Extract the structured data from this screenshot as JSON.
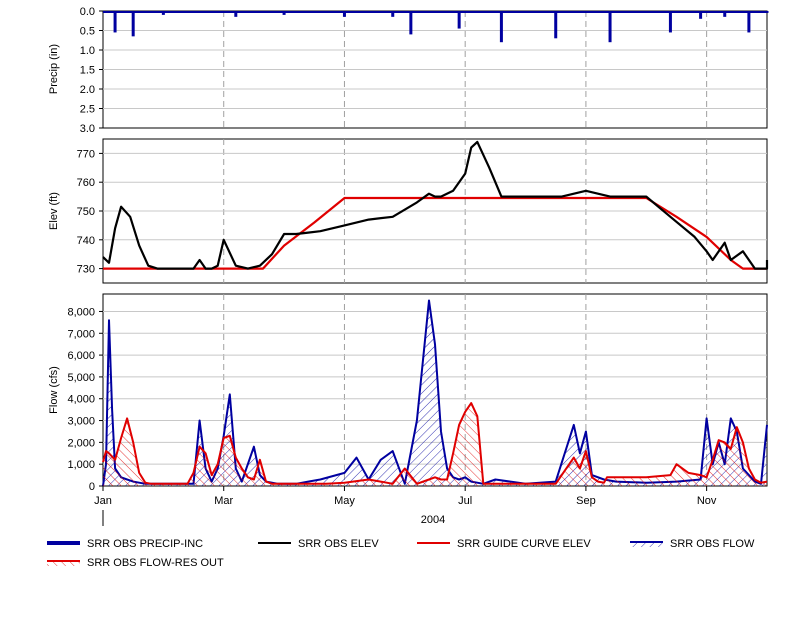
{
  "chart_data": [
    {
      "type": "bar",
      "ylabel": "Precip (in)",
      "ylim": [
        0,
        3.0
      ],
      "y_inverted": true,
      "yticks": [
        "0.0",
        "0.5",
        "1.0",
        "1.5",
        "2.0",
        "2.5",
        "3.0"
      ],
      "series": [
        {
          "name": "SRR OBS PRECIP-INC",
          "color": "#0000a0",
          "x": [
            0.2,
            0.5,
            1.0,
            1.4,
            2.2,
            3.0,
            4.0,
            4.8,
            5.1,
            5.9,
            6.6,
            7.5,
            7.7,
            8.4,
            9.4,
            9.9,
            10.3,
            10.7,
            11.0
          ],
          "values": [
            0.55,
            0.65,
            0.1,
            0.05,
            0.15,
            0.1,
            0.15,
            0.15,
            0.6,
            0.45,
            0.8,
            0.7,
            0.05,
            0.8,
            0.55,
            0.2,
            0.15,
            0.55,
            0.05
          ]
        }
      ]
    },
    {
      "type": "line",
      "ylabel": "Elev (ft)",
      "ylim": [
        725,
        775
      ],
      "yticks": [
        "730",
        "740",
        "750",
        "760",
        "770"
      ],
      "series": [
        {
          "name": "SRR OBS ELEV",
          "color": "#000000",
          "x": [
            0,
            0.1,
            0.2,
            0.3,
            0.45,
            0.6,
            0.75,
            0.9,
            1.5,
            1.6,
            1.7,
            1.8,
            1.9,
            2.0,
            2.2,
            2.4,
            2.6,
            2.8,
            3.0,
            3.2,
            3.4,
            3.6,
            3.8,
            4.0,
            4.4,
            4.8,
            5.2,
            5.4,
            5.5,
            5.6,
            5.8,
            6.0,
            6.1,
            6.2,
            6.4,
            6.6,
            7.0,
            7.6,
            8.0,
            8.4,
            9.0,
            9.4,
            9.8,
            10.0,
            10.1,
            10.3,
            10.4,
            10.6,
            10.8,
            11.0,
            11.0
          ],
          "values": [
            734,
            732,
            744,
            751.5,
            748,
            738,
            731,
            730,
            730,
            733,
            730,
            730,
            731,
            740,
            731,
            730,
            731,
            735,
            742,
            742,
            742.5,
            743,
            744,
            745,
            747,
            748,
            753,
            756,
            755,
            755,
            757,
            763,
            772,
            774,
            765,
            755,
            755,
            755,
            757,
            755,
            755,
            748,
            741,
            736,
            733,
            739,
            733,
            736,
            730,
            730,
            733
          ]
        },
        {
          "name": "SRR GUIDE CURVE ELEV",
          "color": "#e00000",
          "x": [
            0,
            2.65,
            3.0,
            3.5,
            4.0,
            5.0,
            6.0,
            7.0,
            8.0,
            8.3,
            9.0,
            9.5,
            10.0,
            10.4,
            10.6,
            11.0
          ],
          "values": [
            730,
            730,
            738,
            746,
            754.5,
            754.5,
            754.5,
            754.5,
            754.5,
            754.5,
            754.5,
            748,
            741,
            733,
            730,
            730
          ]
        }
      ]
    },
    {
      "type": "area",
      "ylabel": "Flow (cfs)",
      "xlabel": "2004",
      "categories": [
        "Jan",
        "Mar",
        "May",
        "Jul",
        "Sep",
        "Nov"
      ],
      "ylim": [
        0,
        8800
      ],
      "yticks": [
        "0",
        "1,000",
        "2,000",
        "3,000",
        "4,000",
        "5,000",
        "6,000",
        "7,000",
        "8,000"
      ],
      "series": [
        {
          "name": "SRR OBS FLOW",
          "color": "#0000a0",
          "x": [
            0,
            0.05,
            0.1,
            0.15,
            0.2,
            0.3,
            0.4,
            0.5,
            0.6,
            0.7,
            0.8,
            1.0,
            1.4,
            1.5,
            1.6,
            1.7,
            1.8,
            1.9,
            2.0,
            2.1,
            2.2,
            2.3,
            2.5,
            2.6,
            2.7,
            2.9,
            3.0,
            3.2,
            3.4,
            3.6,
            4.0,
            4.2,
            4.4,
            4.6,
            4.8,
            5.0,
            5.2,
            5.4,
            5.5,
            5.6,
            5.7,
            5.8,
            5.9,
            6.0,
            6.1,
            6.2,
            6.3,
            6.5,
            7.0,
            7.5,
            7.8,
            7.9,
            8.0,
            8.1,
            8.3,
            8.5,
            9.0,
            9.5,
            9.9,
            10.0,
            10.1,
            10.2,
            10.3,
            10.4,
            10.5,
            10.6,
            10.8,
            10.9,
            11.0
          ],
          "values": [
            0,
            1000,
            7600,
            3500,
            800,
            400,
            300,
            200,
            150,
            100,
            100,
            100,
            100,
            100,
            3000,
            800,
            200,
            800,
            2300,
            4200,
            800,
            200,
            1800,
            500,
            200,
            100,
            100,
            100,
            200,
            300,
            600,
            1300,
            300,
            1200,
            1600,
            100,
            3000,
            8500,
            6500,
            2500,
            800,
            400,
            300,
            400,
            200,
            150,
            100,
            300,
            100,
            200,
            2800,
            1500,
            2500,
            500,
            300,
            200,
            150,
            200,
            300,
            3100,
            1000,
            2000,
            1000,
            3100,
            2500,
            800,
            200,
            100,
            2800
          ]
        },
        {
          "name": "SRR OBS FLOW-RES OUT",
          "color": "#e00000",
          "x": [
            0,
            0.05,
            0.1,
            0.2,
            0.3,
            0.4,
            0.5,
            0.6,
            0.7,
            0.8,
            1.4,
            1.5,
            1.6,
            1.7,
            1.8,
            1.9,
            2.0,
            2.1,
            2.2,
            2.3,
            2.4,
            2.5,
            2.6,
            2.7,
            2.8,
            3.0,
            3.4,
            3.7,
            4.0,
            4.4,
            4.6,
            4.8,
            5.0,
            5.2,
            5.4,
            5.5,
            5.6,
            5.7,
            5.8,
            5.9,
            6.0,
            6.1,
            6.2,
            6.3,
            7.0,
            7.5,
            7.8,
            7.9,
            8.0,
            8.1,
            8.2,
            8.3,
            8.35,
            9.0,
            9.4,
            9.5,
            9.7,
            9.9,
            10.0,
            10.1,
            10.2,
            10.3,
            10.4,
            10.5,
            10.6,
            10.7,
            10.8,
            10.9,
            11.0
          ],
          "values": [
            1100,
            1600,
            1500,
            1200,
            2200,
            3100,
            2000,
            600,
            150,
            100,
            100,
            600,
            1800,
            1500,
            500,
            1000,
            2200,
            2300,
            1300,
            800,
            400,
            300,
            1200,
            200,
            100,
            100,
            100,
            100,
            150,
            300,
            200,
            100,
            800,
            100,
            300,
            400,
            300,
            300,
            1500,
            2800,
            3400,
            3800,
            3200,
            100,
            100,
            100,
            1300,
            800,
            1600,
            400,
            200,
            150,
            400,
            400,
            500,
            1000,
            600,
            500,
            400,
            1200,
            2100,
            2000,
            1700,
            2700,
            2000,
            800,
            300,
            150,
            200
          ]
        }
      ]
    }
  ],
  "legend": [
    {
      "label": "SRR OBS PRECIP-INC",
      "style": "thick-line",
      "color": "#0000a0"
    },
    {
      "label": "SRR OBS ELEV",
      "style": "line",
      "color": "#000000"
    },
    {
      "label": "SRR GUIDE CURVE ELEV",
      "style": "line",
      "color": "#e00000"
    },
    {
      "label": "SRR OBS FLOW",
      "style": "hatch",
      "color": "#0000a0"
    },
    {
      "label": "SRR OBS FLOW-RES OUT",
      "style": "hatch",
      "color": "#e00000"
    }
  ]
}
